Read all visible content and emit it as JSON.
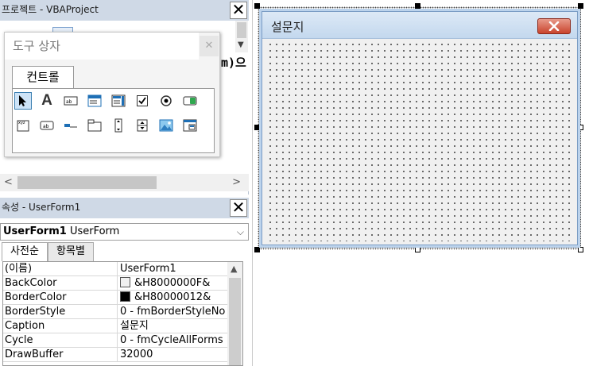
{
  "project": {
    "title": "프로젝트 - VBAProject",
    "close_label": "✕",
    "tree_text": "m)으"
  },
  "toolbox": {
    "title": "도구 상자",
    "close_label": "✕",
    "tab_label": "컨트롤",
    "tools": [
      "pointer-icon",
      "label-icon",
      "textbox-icon",
      "combobox-icon",
      "listbox-icon",
      "checkbox-icon",
      "optionbutton-icon",
      "togglebutton-icon",
      "frame-icon",
      "commandbutton-icon",
      "tabstrip-icon",
      "multipage-icon",
      "scrollbar-icon",
      "spinbutton-icon",
      "image-icon",
      "refedit-icon"
    ]
  },
  "properties": {
    "title": "속성 - UserForm1",
    "close_label": "✕",
    "object_name": "UserForm1",
    "object_type": "UserForm",
    "tab_alpha": "사전순",
    "tab_categorized": "항목별",
    "rows": [
      {
        "name": "(이름)",
        "value": "UserForm1"
      },
      {
        "name": "BackColor",
        "value": "&H8000000F&",
        "swatch": "#f0f0f0"
      },
      {
        "name": "BorderColor",
        "value": "&H80000012&",
        "swatch": "#000000"
      },
      {
        "name": "BorderStyle",
        "value": "0 - fmBorderStyleNo"
      },
      {
        "name": "Caption",
        "value": "설문지"
      },
      {
        "name": "Cycle",
        "value": "0 - fmCycleAllForms"
      },
      {
        "name": "DrawBuffer",
        "value": "32000"
      }
    ]
  },
  "userform": {
    "caption": "설문지"
  },
  "colors": {
    "pane_title_bg": "#cfd9e6",
    "form_title_gradient_top": "#dde9f6",
    "close_button_red": "#c9442d",
    "selected_tool": "#cde3f7"
  }
}
